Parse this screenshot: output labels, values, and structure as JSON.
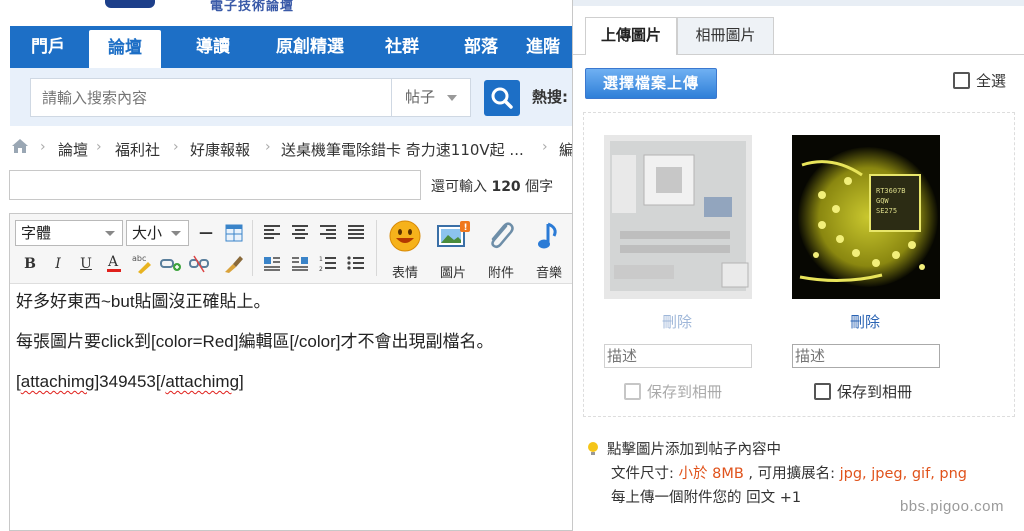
{
  "site": {
    "logo_caption": "電子技術論壇"
  },
  "nav": {
    "items": [
      {
        "label": "門戶",
        "active": false
      },
      {
        "label": "論壇",
        "active": true
      },
      {
        "label": "導讀",
        "active": false
      },
      {
        "label": "原創精選",
        "active": false
      },
      {
        "label": "社群",
        "active": false
      },
      {
        "label": "部落",
        "active": false
      },
      {
        "label": "進階",
        "active": false
      }
    ]
  },
  "search": {
    "placeholder": "請輸入搜索內容",
    "scope_value": "帖子",
    "hot_label": "熱搜:"
  },
  "breadcrumb": {
    "home_icon": "home-icon",
    "items": [
      "論壇",
      "福利社",
      "好康報報",
      "送桌機筆電除錯卡 奇力速110V起 ...",
      "編"
    ]
  },
  "title_field": {
    "value": "",
    "remaining_prefix": "還可輸入",
    "remaining_count": "120",
    "remaining_suffix": "個字"
  },
  "toolbar": {
    "font_select": "字體",
    "size_select": "大小",
    "big_tools": [
      {
        "icon": "smiley-icon",
        "label": "表情"
      },
      {
        "icon": "picture-icon",
        "label": "圖片"
      },
      {
        "icon": "paperclip-icon",
        "label": "附件"
      },
      {
        "icon": "music-note-icon",
        "label": "音樂"
      }
    ]
  },
  "editor": {
    "line1": "好多好東西~but貼圖沒正確貼上。",
    "line2": "每張圖片要click到[color=Red]編輯區[/color]才不會出現副檔名。",
    "line3_prefix": "[",
    "line3_tag_open": "attachimg",
    "line3_mid": "]349453[/",
    "line3_tag_close": "attachimg",
    "line3_suffix": "]"
  },
  "dialog": {
    "tabs": [
      {
        "label": "上傳圖片",
        "active": true
      },
      {
        "label": "相冊圖片",
        "active": false
      }
    ],
    "upload_button": "選擇檔案上傳",
    "select_all": "全選",
    "images": [
      {
        "alt": "motherboard",
        "delete_label": "刪除",
        "description_placeholder": "描述",
        "save_label": "保存到相冊",
        "enabled": false
      },
      {
        "alt": "chip closeup",
        "delete_label": "刪除",
        "description_placeholder": "描述",
        "save_label": "保存到相冊",
        "enabled": true
      }
    ],
    "tips": {
      "line1": "點擊圖片添加到帖子內容中",
      "size_prefix": "文件尺寸: ",
      "size_value": "小於 8MB",
      "ext_prefix": " , 可用擴展名: ",
      "ext_value": "jpg, jpeg, gif, png",
      "line3": "每上傳一個附件您的 回文 +1"
    },
    "colors": {
      "accent": "#1d6fc6",
      "link": "#2a63b3",
      "warn": "#e0531c"
    }
  },
  "watermark": "bbs.pigoo.com"
}
